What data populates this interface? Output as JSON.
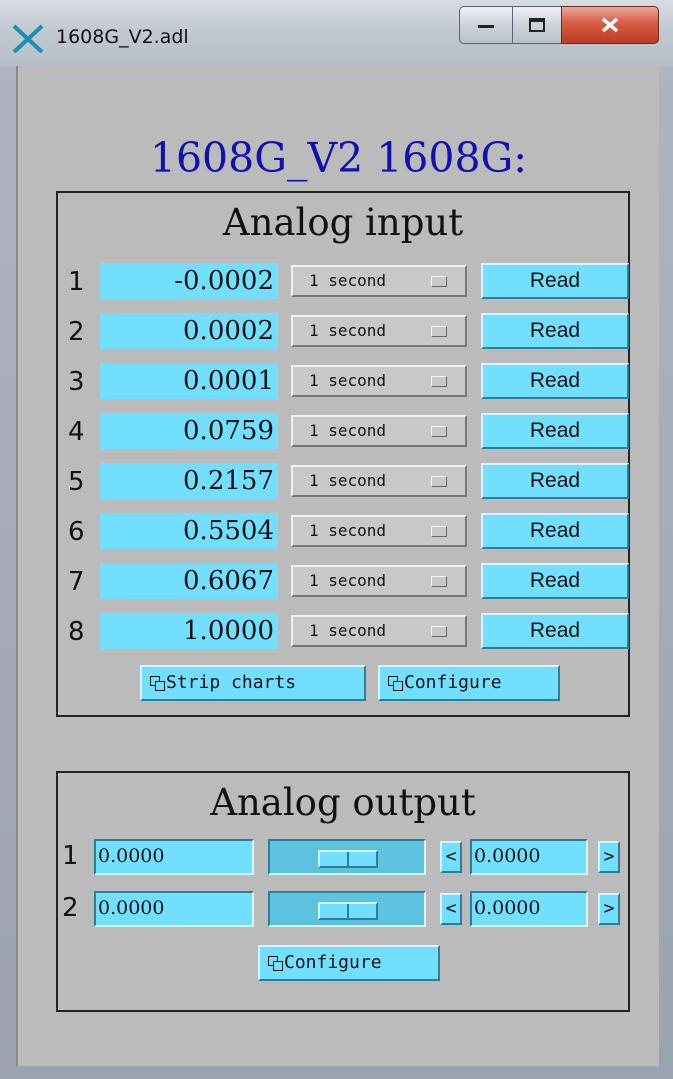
{
  "window": {
    "title": "1608G_V2.adl"
  },
  "header": {
    "title": "1608G_V2  1608G:"
  },
  "analog_input": {
    "title": "Analog input",
    "rows": [
      {
        "num": "1",
        "value": "-0.0002",
        "period": "1 second",
        "read_label": "Read"
      },
      {
        "num": "2",
        "value": "0.0002",
        "period": "1 second",
        "read_label": "Read"
      },
      {
        "num": "3",
        "value": "0.0001",
        "period": "1 second",
        "read_label": "Read"
      },
      {
        "num": "4",
        "value": "0.0759",
        "period": "1 second",
        "read_label": "Read"
      },
      {
        "num": "5",
        "value": "0.2157",
        "period": "1 second",
        "read_label": "Read"
      },
      {
        "num": "6",
        "value": "0.5504",
        "period": "1 second",
        "read_label": "Read"
      },
      {
        "num": "7",
        "value": "0.6067",
        "period": "1 second",
        "read_label": "Read"
      },
      {
        "num": "8",
        "value": "1.0000",
        "period": "1 second",
        "read_label": "Read"
      }
    ],
    "strip_charts_label": "Strip charts",
    "configure_label": "Configure"
  },
  "analog_output": {
    "title": "Analog output",
    "rows": [
      {
        "num": "1",
        "value": "0.0000",
        "slider_level": 0.5,
        "increment": "0.0000",
        "dec_label": "<",
        "inc_label": ">"
      },
      {
        "num": "2",
        "value": "0.0000",
        "slider_level": 0.5,
        "increment": "0.0000",
        "dec_label": "<",
        "inc_label": ">"
      }
    ],
    "configure_label": "Configure"
  },
  "colors": {
    "field": "#73dfff",
    "background": "#bbbbbb",
    "heading": "#1010b0"
  },
  "icons": {
    "app": "x-cross-icon",
    "related_display": "related-display-icon"
  }
}
